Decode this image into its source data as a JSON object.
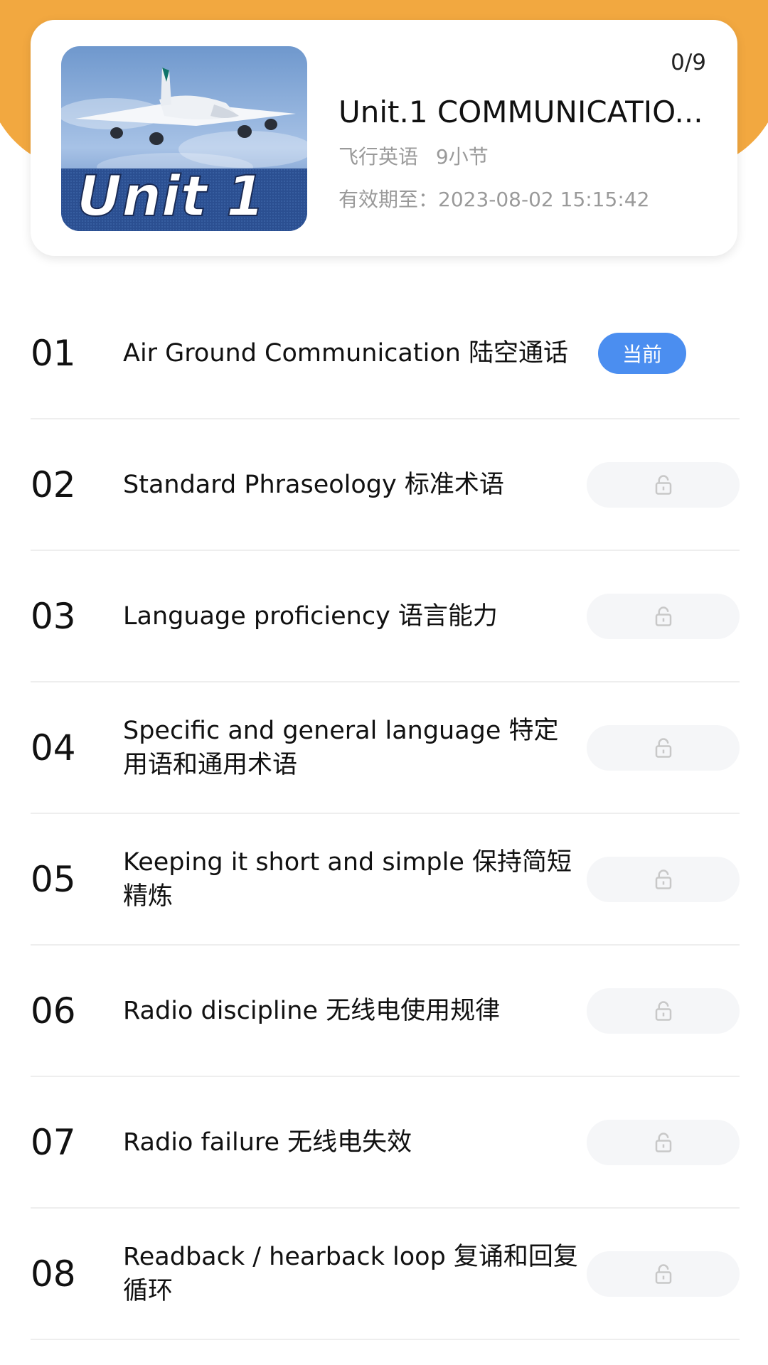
{
  "course": {
    "progress": "0/9",
    "title": "Unit.1 COMMUNICATIO...",
    "category": "飞行英语",
    "sections": "9小节",
    "expiry": "有效期至：2023-08-02 15:15:42",
    "cover_text": "Unit 1"
  },
  "lessons": [
    {
      "num": "01",
      "title": "Air Ground Communication 陆空通话",
      "status": "当前"
    },
    {
      "num": "02",
      "title": " Standard Phraseology 标准术语"
    },
    {
      "num": "03",
      "title": "Language proficiency 语言能力"
    },
    {
      "num": "04",
      "title": "Specific and general language 特定用语和通用术语"
    },
    {
      "num": "05",
      "title": "Keeping it short and simple 保持简短精炼"
    },
    {
      "num": "06",
      "title": " Radio discipline 无线电使用规律"
    },
    {
      "num": "07",
      "title": " Radio failure 无线电失效"
    },
    {
      "num": "08",
      "title": " Readback / hearback loop 复诵和回复循环"
    }
  ],
  "colors": {
    "header": "#f2a840",
    "current_badge": "#4b8ef0",
    "lock_bg": "#f5f6f8"
  },
  "icons": {
    "locked": "lock-icon"
  }
}
